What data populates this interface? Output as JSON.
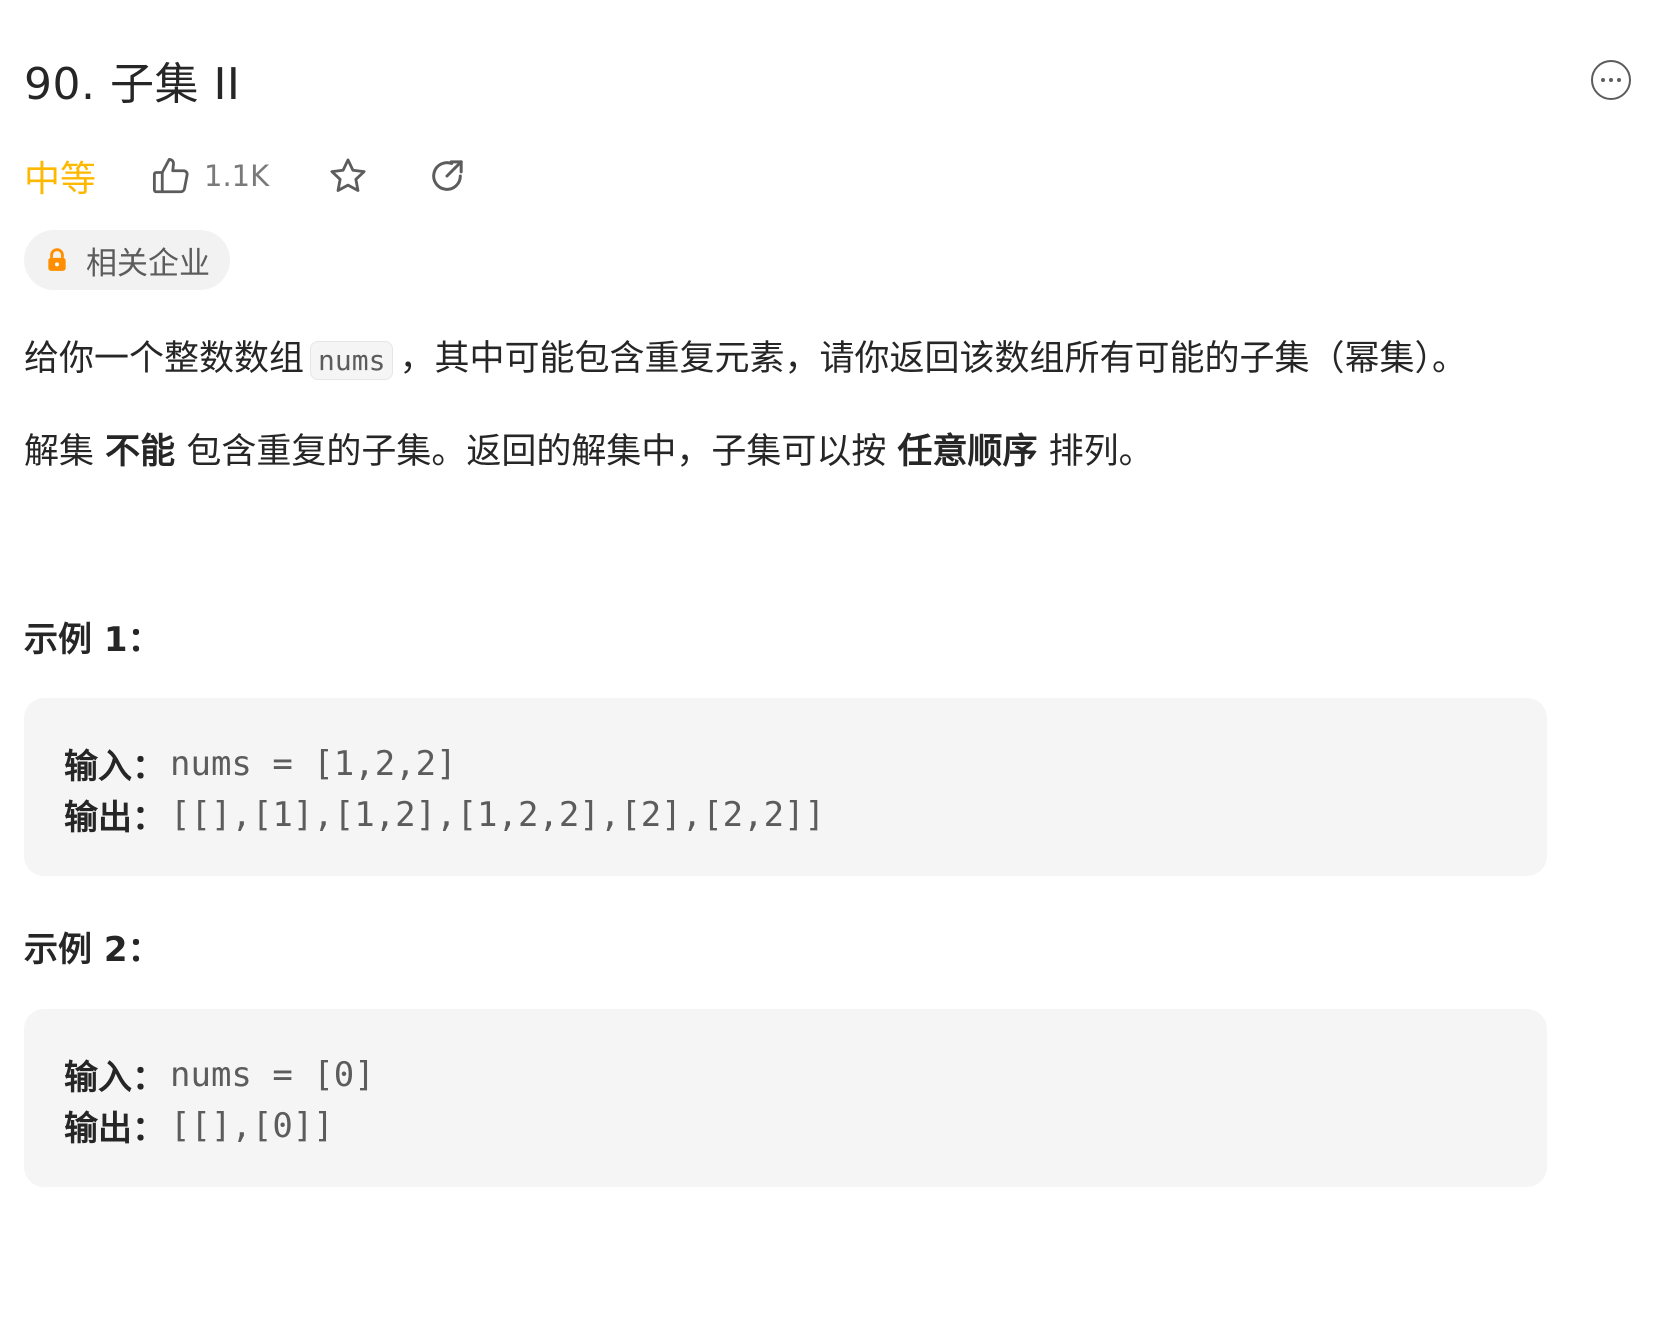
{
  "problem": {
    "title": "90. 子集 II",
    "difficulty": "中等",
    "likes": "1.1K",
    "company_tag": "相关企业"
  },
  "icons": {
    "more": "more-horizontal-icon",
    "like": "thumbs-up-icon",
    "star": "star-icon",
    "share": "share-icon",
    "lock": "lock-icon"
  },
  "colors": {
    "difficulty_medium": "#ffb800",
    "lock": "#ff8f00",
    "text": "#262626",
    "muted": "#5c5c5c",
    "code_bg": "#f5f5f5"
  },
  "description": {
    "p1_before": "给你一个整数数组",
    "p1_code": "nums",
    "p1_after": "，其中可能包含重复元素，请你返回该数组所有可能的子集（幂集）。",
    "p2_a": "解集",
    "p2_bold1": "不能",
    "p2_b": "包含重复的子集。返回的解集中，子集可以按",
    "p2_bold2": "任意顺序",
    "p2_c": "排列。"
  },
  "examples": [
    {
      "title": "示例 1：",
      "input_label": "输入：",
      "input_value": "nums = [1,2,2]",
      "output_label": "输出：",
      "output_value": "[[],[1],[1,2],[1,2,2],[2],[2,2]]"
    },
    {
      "title": "示例 2：",
      "input_label": "输入：",
      "input_value": "nums = [0]",
      "output_label": "输出：",
      "output_value": "[[],[0]]"
    }
  ]
}
